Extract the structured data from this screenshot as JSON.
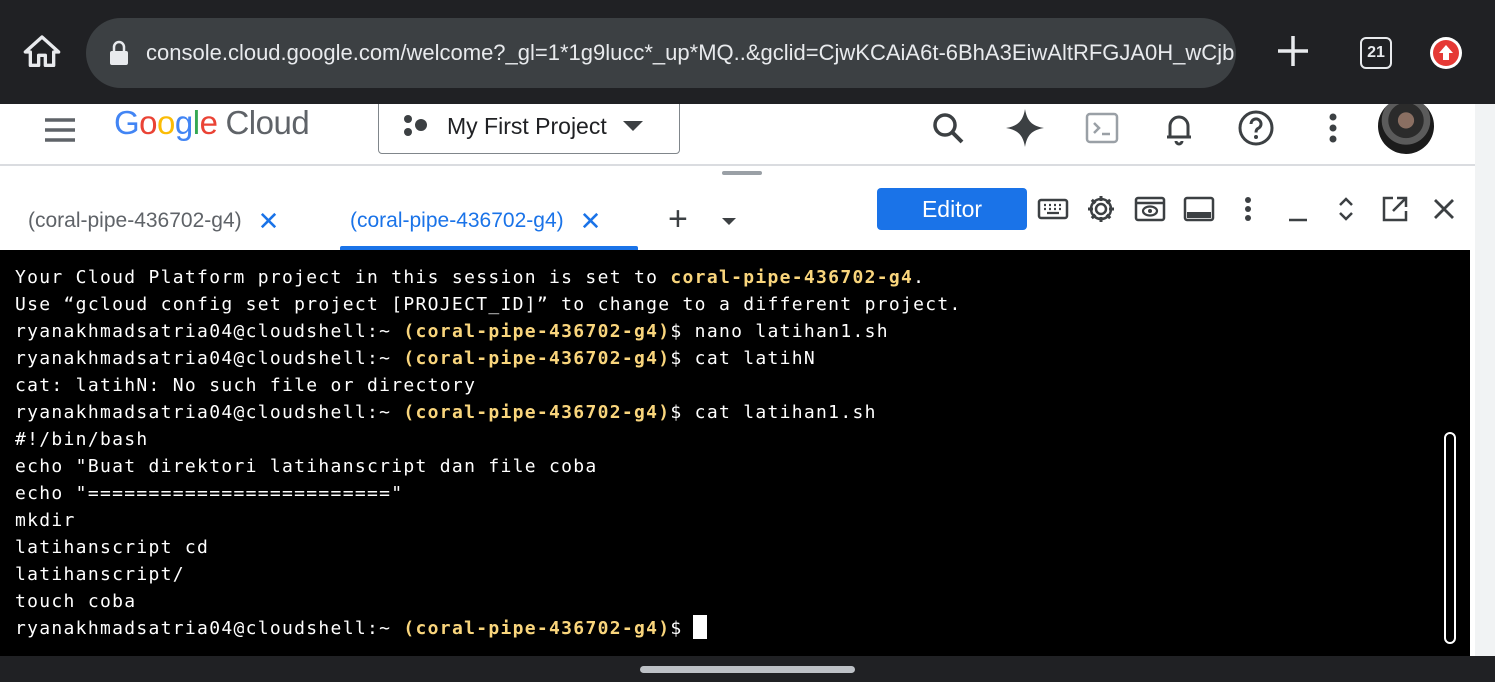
{
  "browser": {
    "url": "console.cloud.google.com/welcome?_gl=1*1g9lucc*_up*MQ..&gclid=CjwKCAiA6t-6BhA3EiwAltRFGJA0H_wCjb",
    "tab_count": "21"
  },
  "header": {
    "logo_google": "Google",
    "logo_cloud": "Cloud",
    "project_name": "My First Project"
  },
  "shell": {
    "tabs": [
      {
        "label": "(coral-pipe-436702-g4)",
        "close": "✕",
        "active": false
      },
      {
        "label": "(coral-pipe-436702-g4)",
        "close": "✕",
        "active": true
      }
    ],
    "add_tab": "+",
    "editor_label": "Editor"
  },
  "terminal": {
    "lines": [
      {
        "pre": "Your Cloud Platform project in this session is set to ",
        "proj": "coral-pipe-436702-g4",
        "post": "."
      },
      {
        "pre": "Use “gcloud config set project [PROJECT_ID]” to change to a different project.",
        "proj": "",
        "post": ""
      },
      {
        "pre": "ryanakhmadsatria04@cloudshell:~ ",
        "proj": "(coral-pipe-436702-g4)",
        "post": "$ nano latihan1.sh"
      },
      {
        "pre": "ryanakhmadsatria04@cloudshell:~ ",
        "proj": "(coral-pipe-436702-g4)",
        "post": "$ cat latihN"
      },
      {
        "pre": "cat: latihN: No such file or directory",
        "proj": "",
        "post": ""
      },
      {
        "pre": "ryanakhmadsatria04@cloudshell:~ ",
        "proj": "(coral-pipe-436702-g4)",
        "post": "$ cat latihan1.sh"
      },
      {
        "pre": "#!/bin/bash",
        "proj": "",
        "post": ""
      },
      {
        "pre": "echo \"Buat direktori latihanscript dan file coba",
        "proj": "",
        "post": ""
      },
      {
        "pre": "echo \"=========================\"",
        "proj": "",
        "post": ""
      },
      {
        "pre": "mkdir",
        "proj": "",
        "post": ""
      },
      {
        "pre": "latihanscript cd",
        "proj": "",
        "post": ""
      },
      {
        "pre": "latihanscript/",
        "proj": "",
        "post": ""
      },
      {
        "pre": "touch coba",
        "proj": "",
        "post": ""
      },
      {
        "pre": "ryanakhmadsatria04@cloudshell:~ ",
        "proj": "(coral-pipe-436702-g4)",
        "post": "$"
      }
    ]
  }
}
